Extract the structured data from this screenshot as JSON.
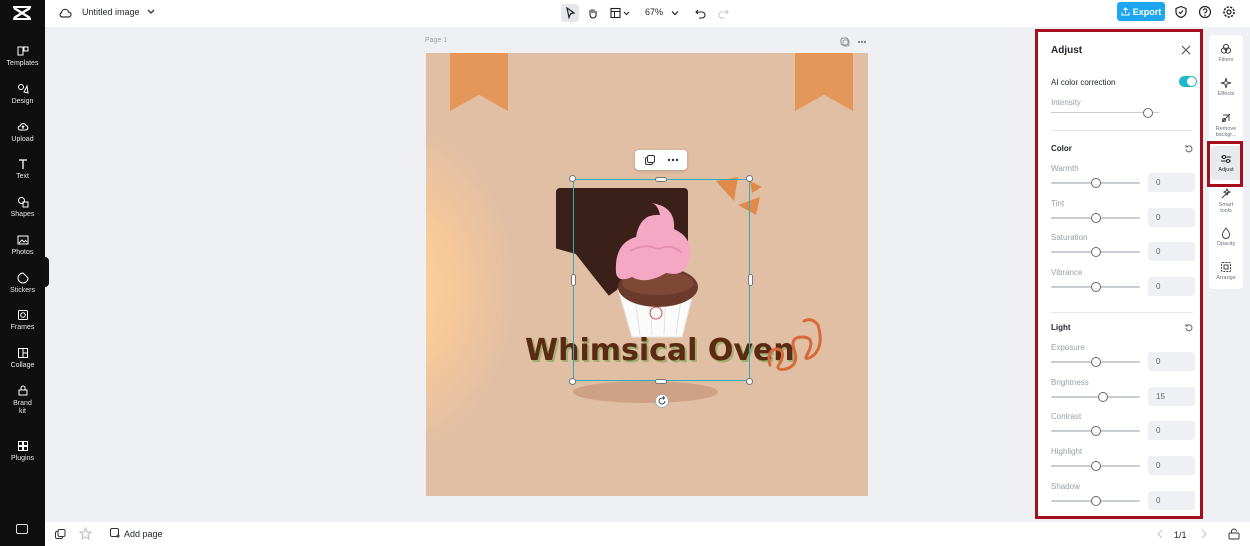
{
  "app": {
    "file_title": "Untitled image",
    "zoom": "67%",
    "export_label": "Export",
    "add_page_label": "Add page",
    "page_counter": "1/1",
    "page_label": "Page 1"
  },
  "left_nav": [
    {
      "label": "Templates",
      "icon": "templates-icon"
    },
    {
      "label": "Design",
      "icon": "design-icon"
    },
    {
      "label": "Upload",
      "icon": "upload-icon"
    },
    {
      "label": "Text",
      "icon": "text-icon"
    },
    {
      "label": "Shapes",
      "icon": "shapes-icon"
    },
    {
      "label": "Photos",
      "icon": "photos-icon"
    },
    {
      "label": "Stickers",
      "icon": "stickers-icon"
    },
    {
      "label": "Frames",
      "icon": "frames-icon"
    },
    {
      "label": "Collage",
      "icon": "collage-icon"
    },
    {
      "label": "Brand kit",
      "icon": "brand-kit-icon"
    },
    {
      "label": "Plugins",
      "icon": "plugins-icon"
    }
  ],
  "canvas": {
    "headline": "Whimsical Oven"
  },
  "adjust_panel": {
    "title": "Adjust",
    "ai_correction_label": "AI color correction",
    "ai_correction_on": true,
    "intensity_label": "Intensity",
    "intensity_value": 0.9,
    "color_section": {
      "title": "Color",
      "rows": [
        {
          "label": "Warmth",
          "value": "0",
          "position": 0.5
        },
        {
          "label": "Tint",
          "value": "0",
          "position": 0.5
        },
        {
          "label": "Saturation",
          "value": "0",
          "position": 0.5
        },
        {
          "label": "Vibrance",
          "value": "0",
          "position": 0.5
        }
      ]
    },
    "light_section": {
      "title": "Light",
      "rows": [
        {
          "label": "Exposure",
          "value": "0",
          "position": 0.5
        },
        {
          "label": "Brightness",
          "value": "15",
          "position": 0.58
        },
        {
          "label": "Contrast",
          "value": "0",
          "position": 0.5
        },
        {
          "label": "Highlight",
          "value": "0",
          "position": 0.5
        },
        {
          "label": "Shadow",
          "value": "0",
          "position": 0.5
        }
      ]
    }
  },
  "right_rail": [
    {
      "label": "Filters",
      "icon": "filters-icon"
    },
    {
      "label": "Effects",
      "icon": "effects-icon"
    },
    {
      "label": "Remove backgr...",
      "icon": "remove-background-icon"
    },
    {
      "label": "Adjust",
      "icon": "adjust-icon",
      "active": true
    },
    {
      "label": "Smart tools",
      "icon": "smart-tools-icon"
    },
    {
      "label": "Opacity",
      "icon": "opacity-icon"
    },
    {
      "label": "Arrange",
      "icon": "arrange-icon"
    }
  ],
  "colors": {
    "accent": "#1ea7f0",
    "toggle": "#1fb8c6",
    "highlight_border": "#a50e1c",
    "artboard_bg": "#e1bfa4",
    "ribbon": "#e49758",
    "headline": "#5b2a12"
  }
}
